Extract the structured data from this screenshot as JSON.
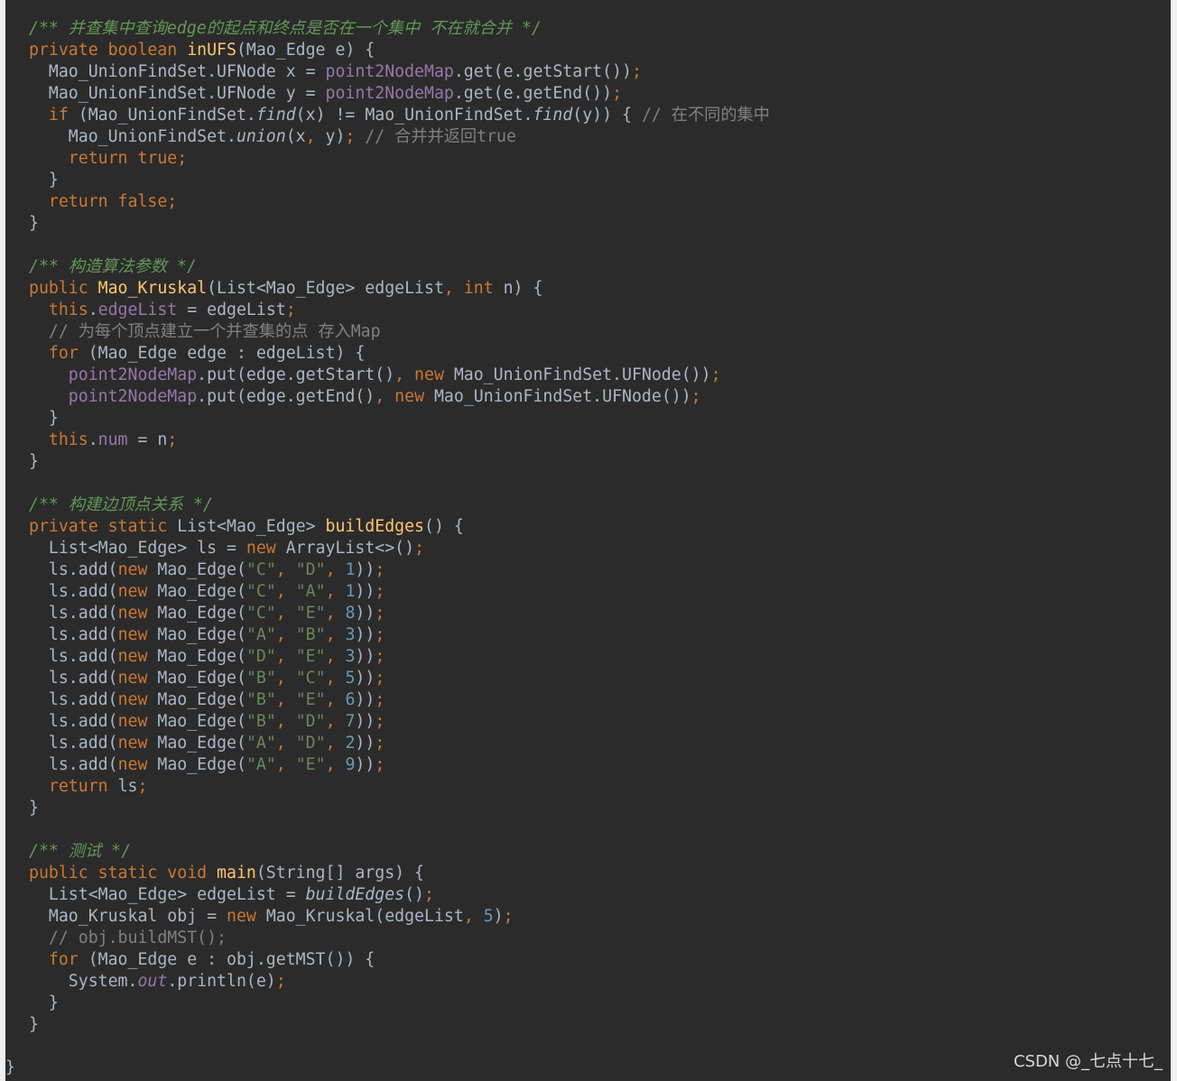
{
  "watermark": "CSDN @_七点十七_",
  "closing_brace": "}",
  "code_lines": [
    [
      [
        "d",
        "/** 并查集中查询edge的起点和终点是否在一个集中 不在就合并 */"
      ]
    ],
    [
      [
        "k",
        "private boolean "
      ],
      [
        "f",
        "inUFS"
      ],
      [
        "t",
        "(Mao_Edge e) {"
      ]
    ],
    [
      [
        "t",
        "  Mao_UnionFindSet.UFNode x = "
      ],
      [
        "p",
        "point2NodeMap"
      ],
      [
        "t",
        ".get(e.getStart())"
      ],
      [
        "k",
        ";"
      ]
    ],
    [
      [
        "t",
        "  Mao_UnionFindSet.UFNode y = "
      ],
      [
        "p",
        "point2NodeMap"
      ],
      [
        "t",
        ".get(e.getEnd())"
      ],
      [
        "k",
        ";"
      ]
    ],
    [
      [
        "k",
        "  if "
      ],
      [
        "t",
        "(Mao_UnionFindSet."
      ],
      [
        "i",
        "find"
      ],
      [
        "t",
        "(x) != Mao_UnionFindSet."
      ],
      [
        "i",
        "find"
      ],
      [
        "t",
        "(y)) { "
      ],
      [
        "c",
        "// 在不同的集中"
      ]
    ],
    [
      [
        "t",
        "    Mao_UnionFindSet."
      ],
      [
        "i",
        "union"
      ],
      [
        "t",
        "(x"
      ],
      [
        "k",
        ", "
      ],
      [
        "t",
        "y)"
      ],
      [
        "k",
        "; "
      ],
      [
        "c",
        "// 合并并返回true"
      ]
    ],
    [
      [
        "k",
        "    return true;"
      ]
    ],
    [
      [
        "t",
        "  }"
      ]
    ],
    [
      [
        "k",
        "  return false;"
      ]
    ],
    [
      [
        "t",
        "}"
      ]
    ],
    [
      [
        "t",
        ""
      ]
    ],
    [
      [
        "d",
        "/** 构造算法参数 */"
      ]
    ],
    [
      [
        "k",
        "public "
      ],
      [
        "f",
        "Mao_Kruskal"
      ],
      [
        "t",
        "(List<Mao_Edge> edgeList"
      ],
      [
        "k",
        ", int "
      ],
      [
        "t",
        "n) {"
      ]
    ],
    [
      [
        "k",
        "  this"
      ],
      [
        "t",
        "."
      ],
      [
        "p",
        "edgeList"
      ],
      [
        "t",
        " = edgeList"
      ],
      [
        "k",
        ";"
      ]
    ],
    [
      [
        "c",
        "  // 为每个顶点建立一个并查集的点 存入Map"
      ]
    ],
    [
      [
        "k",
        "  for "
      ],
      [
        "t",
        "(Mao_Edge edge : edgeList) {"
      ]
    ],
    [
      [
        "p",
        "    point2NodeMap"
      ],
      [
        "t",
        ".put(edge.getStart()"
      ],
      [
        "k",
        ", new "
      ],
      [
        "t",
        "Mao_UnionFindSet.UFNode())"
      ],
      [
        "k",
        ";"
      ]
    ],
    [
      [
        "p",
        "    point2NodeMap"
      ],
      [
        "t",
        ".put(edge.getEnd()"
      ],
      [
        "k",
        ", new "
      ],
      [
        "t",
        "Mao_UnionFindSet.UFNode())"
      ],
      [
        "k",
        ";"
      ]
    ],
    [
      [
        "t",
        "  }"
      ]
    ],
    [
      [
        "k",
        "  this"
      ],
      [
        "t",
        "."
      ],
      [
        "p",
        "num"
      ],
      [
        "t",
        " = n"
      ],
      [
        "k",
        ";"
      ]
    ],
    [
      [
        "t",
        "}"
      ]
    ],
    [
      [
        "t",
        ""
      ]
    ],
    [
      [
        "d",
        "/** 构建边顶点关系 */"
      ]
    ],
    [
      [
        "k",
        "private static "
      ],
      [
        "t",
        "List<Mao_Edge> "
      ],
      [
        "f",
        "buildEdges"
      ],
      [
        "t",
        "() {"
      ]
    ],
    [
      [
        "t",
        "  List<Mao_Edge> ls = "
      ],
      [
        "k",
        "new "
      ],
      [
        "t",
        "ArrayList<>()"
      ],
      [
        "k",
        ";"
      ]
    ],
    [
      [
        "t",
        "  ls.add("
      ],
      [
        "k",
        "new "
      ],
      [
        "t",
        "Mao_Edge("
      ],
      [
        "s",
        "\"C\""
      ],
      [
        "k",
        ", "
      ],
      [
        "s",
        "\"D\""
      ],
      [
        "k",
        ", "
      ],
      [
        "n",
        "1"
      ],
      [
        "t",
        "))"
      ],
      [
        "k",
        ";"
      ]
    ],
    [
      [
        "t",
        "  ls.add("
      ],
      [
        "k",
        "new "
      ],
      [
        "t",
        "Mao_Edge("
      ],
      [
        "s",
        "\"C\""
      ],
      [
        "k",
        ", "
      ],
      [
        "s",
        "\"A\""
      ],
      [
        "k",
        ", "
      ],
      [
        "n",
        "1"
      ],
      [
        "t",
        "))"
      ],
      [
        "k",
        ";"
      ]
    ],
    [
      [
        "t",
        "  ls.add("
      ],
      [
        "k",
        "new "
      ],
      [
        "t",
        "Mao_Edge("
      ],
      [
        "s",
        "\"C\""
      ],
      [
        "k",
        ", "
      ],
      [
        "s",
        "\"E\""
      ],
      [
        "k",
        ", "
      ],
      [
        "n",
        "8"
      ],
      [
        "t",
        "))"
      ],
      [
        "k",
        ";"
      ]
    ],
    [
      [
        "t",
        "  ls.add("
      ],
      [
        "k",
        "new "
      ],
      [
        "t",
        "Mao_Edge("
      ],
      [
        "s",
        "\"A\""
      ],
      [
        "k",
        ", "
      ],
      [
        "s",
        "\"B\""
      ],
      [
        "k",
        ", "
      ],
      [
        "n",
        "3"
      ],
      [
        "t",
        "))"
      ],
      [
        "k",
        ";"
      ]
    ],
    [
      [
        "t",
        "  ls.add("
      ],
      [
        "k",
        "new "
      ],
      [
        "t",
        "Mao_Edge("
      ],
      [
        "s",
        "\"D\""
      ],
      [
        "k",
        ", "
      ],
      [
        "s",
        "\"E\""
      ],
      [
        "k",
        ", "
      ],
      [
        "n",
        "3"
      ],
      [
        "t",
        "))"
      ],
      [
        "k",
        ";"
      ]
    ],
    [
      [
        "t",
        "  ls.add("
      ],
      [
        "k",
        "new "
      ],
      [
        "t",
        "Mao_Edge("
      ],
      [
        "s",
        "\"B\""
      ],
      [
        "k",
        ", "
      ],
      [
        "s",
        "\"C\""
      ],
      [
        "k",
        ", "
      ],
      [
        "n",
        "5"
      ],
      [
        "t",
        "))"
      ],
      [
        "k",
        ";"
      ]
    ],
    [
      [
        "t",
        "  ls.add("
      ],
      [
        "k",
        "new "
      ],
      [
        "t",
        "Mao_Edge("
      ],
      [
        "s",
        "\"B\""
      ],
      [
        "k",
        ", "
      ],
      [
        "s",
        "\"E\""
      ],
      [
        "k",
        ", "
      ],
      [
        "n",
        "6"
      ],
      [
        "t",
        "))"
      ],
      [
        "k",
        ";"
      ]
    ],
    [
      [
        "t",
        "  ls.add("
      ],
      [
        "k",
        "new "
      ],
      [
        "t",
        "Mao_Edge("
      ],
      [
        "s",
        "\"B\""
      ],
      [
        "k",
        ", "
      ],
      [
        "s",
        "\"D\""
      ],
      [
        "k",
        ", "
      ],
      [
        "n",
        "7"
      ],
      [
        "t",
        "))"
      ],
      [
        "k",
        ";"
      ]
    ],
    [
      [
        "t",
        "  ls.add("
      ],
      [
        "k",
        "new "
      ],
      [
        "t",
        "Mao_Edge("
      ],
      [
        "s",
        "\"A\""
      ],
      [
        "k",
        ", "
      ],
      [
        "s",
        "\"D\""
      ],
      [
        "k",
        ", "
      ],
      [
        "n",
        "2"
      ],
      [
        "t",
        "))"
      ],
      [
        "k",
        ";"
      ]
    ],
    [
      [
        "t",
        "  ls.add("
      ],
      [
        "k",
        "new "
      ],
      [
        "t",
        "Mao_Edge("
      ],
      [
        "s",
        "\"A\""
      ],
      [
        "k",
        ", "
      ],
      [
        "s",
        "\"E\""
      ],
      [
        "k",
        ", "
      ],
      [
        "n",
        "9"
      ],
      [
        "t",
        "))"
      ],
      [
        "k",
        ";"
      ]
    ],
    [
      [
        "k",
        "  return "
      ],
      [
        "t",
        "ls"
      ],
      [
        "k",
        ";"
      ]
    ],
    [
      [
        "t",
        "}"
      ]
    ],
    [
      [
        "t",
        ""
      ]
    ],
    [
      [
        "d",
        "/** 测试 */"
      ]
    ],
    [
      [
        "k",
        "public static void "
      ],
      [
        "f",
        "main"
      ],
      [
        "t",
        "(String[] args) {"
      ]
    ],
    [
      [
        "t",
        "  List<Mao_Edge> edgeList = "
      ],
      [
        "i",
        "buildEdges"
      ],
      [
        "t",
        "()"
      ],
      [
        "k",
        ";"
      ]
    ],
    [
      [
        "t",
        "  Mao_Kruskal obj = "
      ],
      [
        "k",
        "new "
      ],
      [
        "t",
        "Mao_Kruskal(edgeList"
      ],
      [
        "k",
        ", "
      ],
      [
        "n",
        "5"
      ],
      [
        "t",
        ")"
      ],
      [
        "k",
        ";"
      ]
    ],
    [
      [
        "c",
        "  // obj.buildMST();"
      ]
    ],
    [
      [
        "k",
        "  for "
      ],
      [
        "t",
        "(Mao_Edge e : obj.getMST()) {"
      ]
    ],
    [
      [
        "t",
        "    System."
      ],
      [
        "pi",
        "out"
      ],
      [
        "t",
        ".println(e)"
      ],
      [
        "k",
        ";"
      ]
    ],
    [
      [
        "t",
        "  }"
      ]
    ],
    [
      [
        "t",
        "}"
      ]
    ]
  ]
}
